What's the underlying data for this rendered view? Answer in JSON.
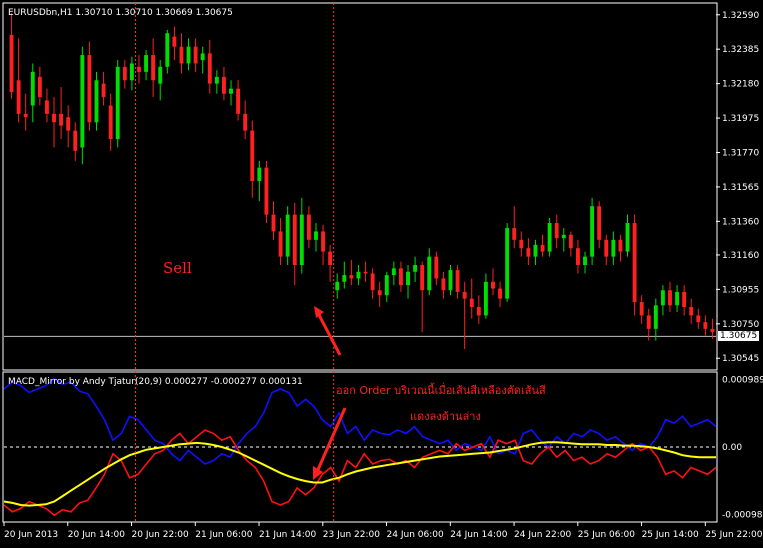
{
  "colors": {
    "background": "#000000",
    "frame": "#ffffff",
    "bull": "#00dd00",
    "bear": "#ff2020",
    "vline": "#ff3030",
    "macd_blue": "#1010ff",
    "macd_red": "#ff1010",
    "macd_yellow": "#ffff00",
    "annotation": "#ff2020"
  },
  "main_chart": {
    "header": "EURUSDbn,H1  1.30710 1.30710 1.30669 1.30675",
    "price_ticks": [
      "1.32590",
      "1.32385",
      "1.32180",
      "1.31975",
      "1.31770",
      "1.31565",
      "1.31360",
      "1.31160",
      "1.30955",
      "1.30750",
      "1.30545"
    ],
    "current_price": "1.30675",
    "annotation_sell": "Sell"
  },
  "indicator": {
    "header": "MACD_Mirror by Andy Tjatur(20,9) 0.000277 -0.000277 0.000131",
    "value_ticks": [
      "0.000989",
      "0.00",
      "-0.000989"
    ],
    "annotation_line1": "ออก Order บริเวณนี้เมื่อเส้นสีเหลืองตัดเส้นสี",
    "annotation_line2": "แดงลงด้านล่าง"
  },
  "time_axis": {
    "labels": [
      "20 Jun 2013",
      "20 Jun 14:00",
      "20 Jun 22:00",
      "21 Jun 06:00",
      "21 Jun 14:00",
      "23 Jun 22:00",
      "24 Jun 06:00",
      "24 Jun 14:00",
      "24 Jun 22:00",
      "25 Jun 06:00",
      "25 Jun 14:00",
      "25 Jun 22:00"
    ]
  },
  "chart_data": {
    "type": "candlestick",
    "symbol": "EURUSDbn",
    "timeframe": "H1",
    "candles_ohlc": [
      [
        1.3247,
        1.326,
        1.3209,
        1.3213
      ],
      [
        1.322,
        1.3245,
        1.3195,
        1.32
      ],
      [
        1.32,
        1.3212,
        1.319,
        1.3198
      ],
      [
        1.3205,
        1.323,
        1.3195,
        1.3225
      ],
      [
        1.3222,
        1.3228,
        1.3205,
        1.321
      ],
      [
        1.3208,
        1.3215,
        1.3195,
        1.32
      ],
      [
        1.32,
        1.321,
        1.318,
        1.3195
      ],
      [
        1.32,
        1.3216,
        1.3185,
        1.3193
      ],
      [
        1.3198,
        1.3205,
        1.318,
        1.319
      ],
      [
        1.319,
        1.3195,
        1.3172,
        1.3178
      ],
      [
        1.318,
        1.324,
        1.317,
        1.3235
      ],
      [
        1.3235,
        1.3243,
        1.319,
        1.3195
      ],
      [
        1.3195,
        1.3225,
        1.319,
        1.322
      ],
      [
        1.3218,
        1.3225,
        1.3205,
        1.321
      ],
      [
        1.3205,
        1.3212,
        1.3178,
        1.3185
      ],
      [
        1.3185,
        1.3232,
        1.318,
        1.3228
      ],
      [
        1.3228,
        1.3232,
        1.3215,
        1.322
      ],
      [
        1.322,
        1.3234,
        1.3214,
        1.323
      ],
      [
        1.3228,
        1.3235,
        1.3218,
        1.3225
      ],
      [
        1.3225,
        1.3238,
        1.322,
        1.3235
      ],
      [
        1.3235,
        1.3245,
        1.321,
        1.322
      ],
      [
        1.3218,
        1.3232,
        1.3208,
        1.3228
      ],
      [
        1.3228,
        1.325,
        1.3224,
        1.3248
      ],
      [
        1.3246,
        1.3252,
        1.3232,
        1.324
      ],
      [
        1.324,
        1.3248,
        1.3224,
        1.323
      ],
      [
        1.323,
        1.3245,
        1.3226,
        1.324
      ],
      [
        1.324,
        1.3245,
        1.3225,
        1.323
      ],
      [
        1.3232,
        1.324,
        1.3224,
        1.3236
      ],
      [
        1.3236,
        1.3244,
        1.3212,
        1.3218
      ],
      [
        1.3218,
        1.3226,
        1.3212,
        1.3222
      ],
      [
        1.3222,
        1.3228,
        1.3208,
        1.3212
      ],
      [
        1.3212,
        1.322,
        1.3205,
        1.3215
      ],
      [
        1.3215,
        1.322,
        1.3196,
        1.32
      ],
      [
        1.32,
        1.3208,
        1.3185,
        1.319
      ],
      [
        1.319,
        1.3196,
        1.315,
        1.316
      ],
      [
        1.316,
        1.3172,
        1.3148,
        1.3168
      ],
      [
        1.3168,
        1.3172,
        1.3135,
        1.314
      ],
      [
        1.314,
        1.3148,
        1.3125,
        1.313
      ],
      [
        1.313,
        1.3138,
        1.311,
        1.3115
      ],
      [
        1.3115,
        1.3145,
        1.311,
        1.314
      ],
      [
        1.314,
        1.3147,
        1.3098,
        1.311
      ],
      [
        1.311,
        1.315,
        1.3105,
        1.314
      ],
      [
        1.314,
        1.3145,
        1.312,
        1.3125
      ],
      [
        1.3125,
        1.3135,
        1.3118,
        1.313
      ],
      [
        1.313,
        1.3134,
        1.311,
        1.3118
      ],
      [
        1.3118,
        1.3122,
        1.31,
        1.311
      ],
      [
        1.3095,
        1.3105,
        1.309,
        1.31
      ],
      [
        1.31,
        1.3112,
        1.3096,
        1.3104
      ],
      [
        1.3104,
        1.3113,
        1.3098,
        1.3102
      ],
      [
        1.3102,
        1.311,
        1.3098,
        1.3106
      ],
      [
        1.3106,
        1.3112,
        1.31,
        1.3105
      ],
      [
        1.3105,
        1.3108,
        1.309,
        1.3095
      ],
      [
        1.3095,
        1.31,
        1.3085,
        1.3092
      ],
      [
        1.3092,
        1.3106,
        1.3088,
        1.3104
      ],
      [
        1.3104,
        1.3112,
        1.3098,
        1.3108
      ],
      [
        1.3108,
        1.3112,
        1.3094,
        1.3098
      ],
      [
        1.3098,
        1.311,
        1.309,
        1.3106
      ],
      [
        1.3106,
        1.3115,
        1.31,
        1.311
      ],
      [
        1.311,
        1.3112,
        1.307,
        1.3095
      ],
      [
        1.3095,
        1.312,
        1.3092,
        1.3115
      ],
      [
        1.3115,
        1.3118,
        1.3098,
        1.3102
      ],
      [
        1.3102,
        1.3106,
        1.309,
        1.3095
      ],
      [
        1.3095,
        1.311,
        1.3092,
        1.3107
      ],
      [
        1.3107,
        1.311,
        1.309,
        1.3094
      ],
      [
        1.3094,
        1.31,
        1.306,
        1.309
      ],
      [
        1.309,
        1.3102,
        1.3078,
        1.3085
      ],
      [
        1.3085,
        1.3092,
        1.3075,
        1.308
      ],
      [
        1.308,
        1.3105,
        1.3078,
        1.31
      ],
      [
        1.31,
        1.3108,
        1.3092,
        1.3096
      ],
      [
        1.3096,
        1.31,
        1.3085,
        1.309
      ],
      [
        1.309,
        1.3135,
        1.3088,
        1.3132
      ],
      [
        1.3132,
        1.3145,
        1.312,
        1.3125
      ],
      [
        1.3125,
        1.313,
        1.3115,
        1.312
      ],
      [
        1.312,
        1.3126,
        1.311,
        1.3115
      ],
      [
        1.3115,
        1.3125,
        1.311,
        1.3122
      ],
      [
        1.3122,
        1.3128,
        1.3115,
        1.3118
      ],
      [
        1.3118,
        1.3138,
        1.3115,
        1.3135
      ],
      [
        1.3135,
        1.314,
        1.312,
        1.3126
      ],
      [
        1.3126,
        1.3132,
        1.3118,
        1.3128
      ],
      [
        1.3128,
        1.313,
        1.3115,
        1.312
      ],
      [
        1.312,
        1.3125,
        1.3105,
        1.311
      ],
      [
        1.311,
        1.3118,
        1.3105,
        1.3115
      ],
      [
        1.3115,
        1.315,
        1.311,
        1.3145
      ],
      [
        1.3145,
        1.3148,
        1.312,
        1.3125
      ],
      [
        1.3125,
        1.3128,
        1.311,
        1.3115
      ],
      [
        1.3115,
        1.313,
        1.311,
        1.3125
      ],
      [
        1.3125,
        1.3128,
        1.3112,
        1.3118
      ],
      [
        1.3118,
        1.314,
        1.3115,
        1.3135
      ],
      [
        1.3135,
        1.314,
        1.308,
        1.3088
      ],
      [
        1.3088,
        1.3092,
        1.3075,
        1.308
      ],
      [
        1.308,
        1.3084,
        1.3065,
        1.3072
      ],
      [
        1.3072,
        1.309,
        1.3065,
        1.3086
      ],
      [
        1.3086,
        1.3098,
        1.308,
        1.3095
      ],
      [
        1.3095,
        1.31,
        1.3082,
        1.3086
      ],
      [
        1.3086,
        1.3098,
        1.3082,
        1.3094
      ],
      [
        1.3094,
        1.3098,
        1.308,
        1.3085
      ],
      [
        1.3085,
        1.309,
        1.3075,
        1.308
      ],
      [
        1.308,
        1.3084,
        1.3072,
        1.3076
      ],
      [
        1.3076,
        1.308,
        1.3068,
        1.3072
      ],
      [
        1.3072,
        1.3078,
        1.3066,
        1.307
      ]
    ],
    "price_ylim": [
      1.30475,
      1.3266
    ],
    "macd_ylim": [
      -0.0011,
      0.0011
    ],
    "series": [
      {
        "name": "",
        "color": "blue",
        "values": [
          0.00085,
          0.00095,
          0.0009,
          0.0008,
          0.00085,
          0.0009,
          0.001,
          0.00092,
          0.00095,
          0.00082,
          0.00078,
          0.0006,
          0.0004,
          0.0001,
          0.0002,
          0.00045,
          0.0004,
          0.00025,
          0.0001,
          5e-05,
          -0.0001,
          -0.0002,
          -5e-05,
          -0.00015,
          -0.00025,
          -0.0002,
          -0.0001,
          -0.00015,
          5e-05,
          0.0002,
          0.0003,
          0.0005,
          0.0008,
          0.00085,
          0.0008,
          0.0006,
          0.0007,
          0.0006,
          0.0004,
          0.0003,
          0.0005,
          0.0002,
          0.0003,
          0.0001,
          0.00025,
          0.0002,
          0.00018,
          0.00025,
          0.0002,
          0.0003,
          0.00015,
          0.0001,
          5e-05,
          0.0001,
          -5e-05,
          5e-05,
          0.0,
          -5e-05,
          0.00015,
          -0.0001,
          -5e-05,
          -0.0001,
          0.0002,
          0.00025,
          0.0001,
          0.0,
          0.00015,
          5e-05,
          0.0002,
          0.00015,
          0.00025,
          0.0002,
          0.0001,
          0.00015,
          5e-05,
          -5e-05,
          5e-05,
          0.0,
          0.00015,
          0.0004,
          0.00035,
          0.00045,
          0.0003,
          0.00035,
          0.0004,
          0.0003
        ]
      },
      {
        "name": "",
        "color": "red",
        "values": [
          -0.00085,
          -0.00095,
          -0.0009,
          -0.0008,
          -0.00085,
          -0.0009,
          -0.001,
          -0.00092,
          -0.00095,
          -0.00082,
          -0.00078,
          -0.0006,
          -0.0004,
          -0.0001,
          -0.0002,
          -0.00045,
          -0.0004,
          -0.00025,
          -0.0001,
          -5e-05,
          0.0001,
          0.0002,
          5e-05,
          0.00015,
          0.00025,
          0.0002,
          0.0001,
          0.00015,
          -5e-05,
          -0.0002,
          -0.0003,
          -0.0005,
          -0.0008,
          -0.00085,
          -0.0008,
          -0.0006,
          -0.0007,
          -0.0006,
          -0.0004,
          -0.0003,
          -0.0005,
          -0.0002,
          -0.0003,
          -0.0001,
          -0.00025,
          -0.0002,
          -0.00018,
          -0.00025,
          -0.0002,
          -0.0003,
          -0.00015,
          -0.0001,
          -5e-05,
          -0.0001,
          5e-05,
          -5e-05,
          0.0,
          5e-05,
          -0.00015,
          0.0001,
          5e-05,
          0.0001,
          -0.0002,
          -0.00025,
          -0.0001,
          0.0,
          -0.00015,
          -5e-05,
          -0.0002,
          -0.00015,
          -0.00025,
          -0.0002,
          -0.0001,
          -0.00015,
          -5e-05,
          5e-05,
          -5e-05,
          0.0,
          -0.00015,
          -0.0004,
          -0.00035,
          -0.00045,
          -0.0003,
          -0.00035,
          -0.0004,
          -0.0003
        ]
      },
      {
        "name": "",
        "color": "yellow",
        "values": [
          -0.0008,
          -0.00082,
          -0.00085,
          -0.00086,
          -0.00085,
          -0.00084,
          -0.0008,
          -0.00072,
          -0.00064,
          -0.00056,
          -0.00048,
          -0.0004,
          -0.00032,
          -0.00025,
          -0.00018,
          -0.00012,
          -8e-05,
          -4e-05,
          -2e-05,
          0.0,
          2e-05,
          4e-05,
          5e-05,
          6e-05,
          5e-05,
          3e-05,
          0.0,
          -4e-05,
          -8e-05,
          -0.00014,
          -0.0002,
          -0.00026,
          -0.00032,
          -0.00038,
          -0.00043,
          -0.00047,
          -0.0005,
          -0.00052,
          -0.00052,
          -0.00048,
          -0.00045,
          -0.0004,
          -0.00036,
          -0.00033,
          -0.0003,
          -0.00028,
          -0.00026,
          -0.00024,
          -0.00022,
          -0.0002,
          -0.00018,
          -0.00016,
          -0.00014,
          -0.00013,
          -0.00012,
          -0.00011,
          -0.0001,
          -9e-05,
          -8e-05,
          -6e-05,
          -4e-05,
          -2e-05,
          1e-05,
          4e-05,
          6e-05,
          7e-05,
          7e-05,
          6e-05,
          5e-05,
          4e-05,
          4e-05,
          4e-05,
          3e-05,
          3e-05,
          2e-05,
          2e-05,
          1e-05,
          0.0,
          -2e-05,
          -5e-05,
          -8e-05,
          -0.00012,
          -0.00014,
          -0.00015,
          -0.00015,
          -0.00015
        ]
      }
    ],
    "event_lines_after_candle": [
      17,
      45
    ]
  }
}
